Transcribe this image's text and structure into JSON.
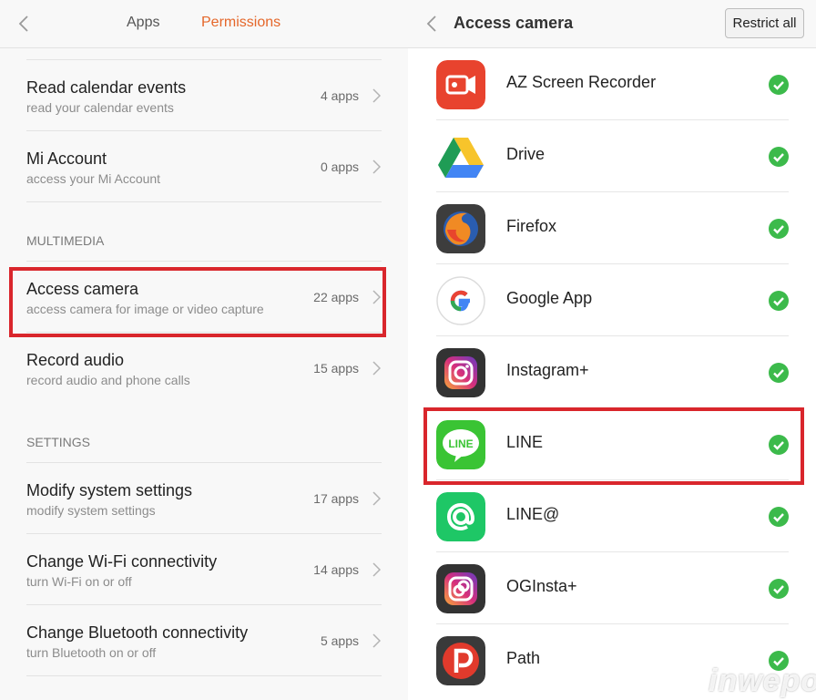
{
  "left_panel": {
    "tabs": [
      {
        "label": "Apps",
        "active": false
      },
      {
        "label": "Permissions",
        "active": true
      }
    ],
    "accent_color": "#e5672a",
    "rows": [
      {
        "title": "Read calendar events",
        "subtitle": "read your calendar events",
        "count": "4 apps"
      },
      {
        "title": "Mi Account",
        "subtitle": "access your Mi Account",
        "count": "0 apps"
      }
    ],
    "sections": [
      {
        "heading": "MULTIMEDIA",
        "rows": [
          {
            "title": "Access camera",
            "subtitle": "access camera for image or video capture",
            "count": "22 apps",
            "highlighted": true
          },
          {
            "title": "Record audio",
            "subtitle": "record audio and phone calls",
            "count": "15 apps"
          }
        ]
      },
      {
        "heading": "SETTINGS",
        "rows": [
          {
            "title": "Modify system settings",
            "subtitle": "modify system settings",
            "count": "17 apps"
          },
          {
            "title": "Change Wi-Fi connectivity",
            "subtitle": "turn Wi-Fi on or off",
            "count": "14 apps"
          },
          {
            "title": "Change Bluetooth connectivity",
            "subtitle": "turn Bluetooth on or off",
            "count": "5 apps"
          }
        ]
      }
    ]
  },
  "right_panel": {
    "title": "Access camera",
    "restrict_button": "Restrict all",
    "check_color": "#3cba4b",
    "apps": [
      {
        "name": "AZ Screen Recorder",
        "icon": "az-screen-recorder-icon",
        "allowed": true
      },
      {
        "name": "Drive",
        "icon": "google-drive-icon",
        "allowed": true
      },
      {
        "name": "Firefox",
        "icon": "firefox-icon",
        "allowed": true
      },
      {
        "name": "Google App",
        "icon": "google-g-icon",
        "allowed": true
      },
      {
        "name": "Instagram+",
        "icon": "instagram-icon",
        "allowed": true
      },
      {
        "name": "LINE",
        "icon": "line-icon",
        "allowed": true,
        "highlighted": true
      },
      {
        "name": "LINE@",
        "icon": "line-at-icon",
        "allowed": true
      },
      {
        "name": "OGInsta+",
        "icon": "oginsta-icon",
        "allowed": true
      },
      {
        "name": "Path",
        "icon": "path-icon",
        "allowed": true
      }
    ]
  },
  "watermark": "inwepo",
  "highlight_color": "#d9262c"
}
